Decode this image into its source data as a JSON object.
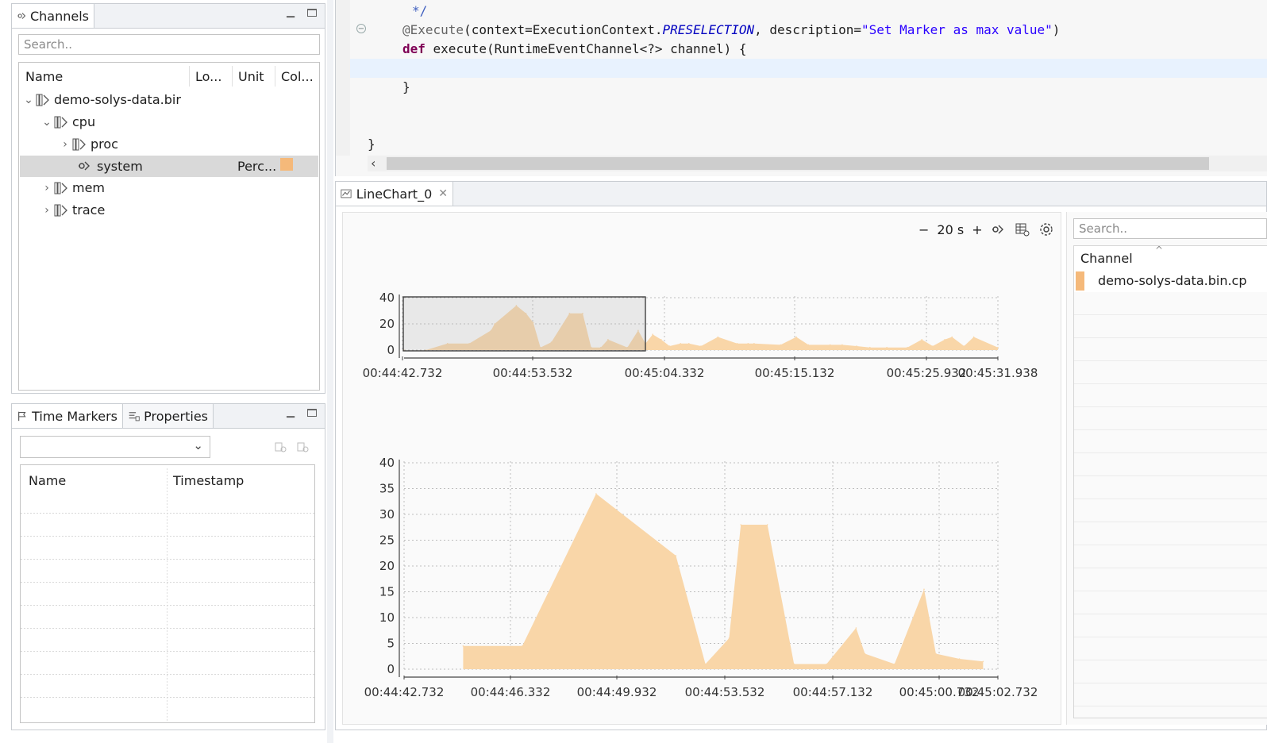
{
  "channels_view": {
    "tab_label": "Channels",
    "search_placeholder": "Search..",
    "columns": [
      "Name",
      "Lo...",
      "Unit",
      "Col..."
    ],
    "tree": [
      {
        "label": "demo-solys-data.bir",
        "expanded": true,
        "level": 0
      },
      {
        "label": "cpu",
        "expanded": true,
        "level": 1
      },
      {
        "label": "proc",
        "expanded": false,
        "level": 2
      },
      {
        "label": "system",
        "level": 2,
        "unit": "Perc...",
        "color": "#f5b97a",
        "selected": true
      },
      {
        "label": "mem",
        "expanded": false,
        "level": 1
      },
      {
        "label": "trace",
        "expanded": false,
        "level": 1
      }
    ]
  },
  "markers_view": {
    "tabs": [
      "Time Markers",
      "Properties"
    ],
    "columns": [
      "Name",
      "Timestamp"
    ]
  },
  "editor": {
    "line_comment": "*/",
    "line_annotation": {
      "at": "@Execute",
      "open": "(context=ExecutionContext.",
      "constant": "PRESELECTION",
      "mid": ", description=",
      "string": "\"Set Marker as max value\"",
      "close": ")"
    },
    "line_def": {
      "keyword": "def",
      "rest": " execute(RuntimeEventChannel<?> channel) {"
    },
    "line_close_inner": "}",
    "line_close_outer": "}"
  },
  "chart_view": {
    "tab_label": "LineChart_0",
    "toolbar": {
      "minus": "−",
      "duration": "20 s",
      "plus": "+"
    },
    "side": {
      "search_placeholder": "Search..",
      "column": "Channel",
      "channel_name": "demo-solys-data.bin.cp",
      "channel_color": "#f5b97a"
    }
  },
  "chart_data": [
    {
      "type": "area",
      "title": "",
      "xlabel": "",
      "ylabel": "",
      "ylim": [
        0,
        40
      ],
      "yticks": [
        0,
        20,
        40
      ],
      "xticks": [
        "00:44:42.732",
        "00:44:53.532",
        "00:45:04.332",
        "00:45:15.132",
        "00:45:25.932",
        "00:45:31.938"
      ],
      "grid": true,
      "series_color": "#f9d6a8",
      "selection_range": [
        "00:44:42.732",
        "00:45:02.732"
      ],
      "x": [
        0,
        1.8,
        3.6,
        5.4,
        7.2,
        7.5,
        9.3,
        10.1,
        10.7,
        11.3,
        12.2,
        13.7,
        14.8,
        15.5,
        16.3,
        16.9,
        18.5,
        19.4,
        20,
        20.6,
        21.3,
        22,
        22.9,
        23.6,
        24.6,
        26,
        27.6,
        28.5,
        29,
        31.2,
        32.5,
        33.5,
        35.3,
        36.3,
        37.5,
        38.6,
        40,
        41.7,
        42.9,
        43.8,
        44.8,
        45.4,
        46.4,
        47.2,
        49.2
      ],
      "values": [
        0,
        0,
        5,
        5,
        15,
        20,
        34,
        28,
        21,
        2,
        6,
        28,
        28,
        2,
        2,
        8,
        2,
        15,
        5,
        12,
        8,
        3,
        5,
        5,
        3,
        10,
        5,
        5,
        5,
        4,
        10,
        4,
        4,
        4,
        3,
        2,
        2,
        2,
        8,
        3,
        8,
        10,
        3,
        10,
        2
      ]
    },
    {
      "type": "area",
      "title": "",
      "xlabel": "",
      "ylabel": "",
      "ylim": [
        0,
        40
      ],
      "yticks": [
        0,
        5,
        10,
        15,
        20,
        25,
        30,
        35,
        40
      ],
      "xticks": [
        "00:44:42.732",
        "00:44:46.332",
        "00:44:49.932",
        "00:44:53.532",
        "00:44:57.132",
        "00:45:00.732",
        "00:45:02.732"
      ],
      "grid": true,
      "series_color": "#f9d6a8",
      "x": [
        2,
        4,
        6.5,
        9.2,
        10.2,
        11,
        11.4,
        12.3,
        13.2,
        14.3,
        15.3,
        15.6,
        16.6,
        17.6,
        18,
        18.8,
        19.6
      ],
      "values": [
        4.5,
        4.5,
        34,
        22,
        1,
        6,
        28,
        28,
        1,
        1,
        8,
        3,
        1,
        15.5,
        3,
        2,
        1.5
      ]
    }
  ]
}
